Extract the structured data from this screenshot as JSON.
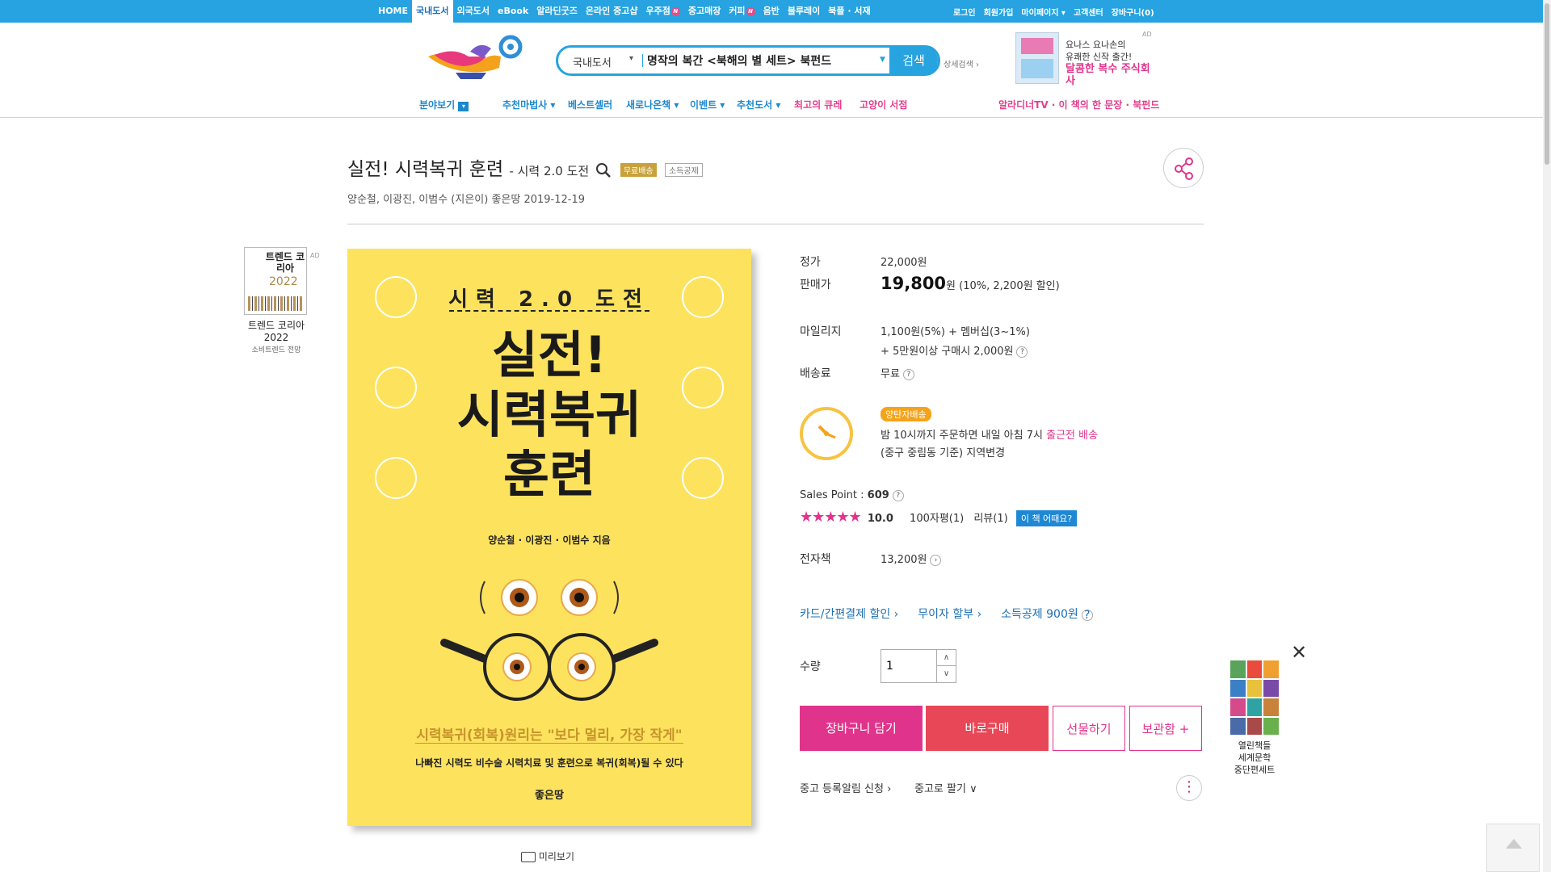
{
  "topnav": {
    "items": [
      "HOME",
      "국내도서",
      "외국도서",
      "eBook",
      "알라딘굿즈",
      "온라인 중고샵",
      "우주점",
      "중고매장",
      "커피",
      "음반",
      "블루레이",
      "북플 · 서재"
    ],
    "active": "국내도서",
    "new_badge": "N",
    "util": [
      "로그인",
      "회원가입",
      "마이페이지 ▾",
      "고객센터",
      "장바구니(0)"
    ]
  },
  "search": {
    "category": "국내도서",
    "value": "명작의 복간 <북해의 별 세트> 북펀드",
    "button": "검색",
    "detail": "상세검색 ›"
  },
  "header_ad": {
    "tag": "AD",
    "line1": "요나스 요나손의",
    "line2": "유쾌한 신작 출간!",
    "line3": "달콤한 복수 주식회사"
  },
  "subnav": {
    "field": "분야보기",
    "items": [
      "추천마법사 ▾",
      "베스트셀러",
      "새로나온책 ▾",
      "이벤트 ▾",
      "추천도서 ▾",
      "최고의 큐레",
      "고양이 서점"
    ],
    "right": "알라디너TV · 이 책의 한 문장 · 북펀드"
  },
  "product": {
    "title": "실전! 시력복귀 훈련",
    "subtitle": "- 시력 2.0 도전",
    "badge_free": "무료배송",
    "badge_tax": "소득공제",
    "authors": "양순철,  이광진,  이범수 (지은이)  좋은땅  2019-12-19",
    "preview": "미리보기"
  },
  "left_ad": {
    "tag": "AD",
    "book_title": "트렌드 코리아",
    "book_year": "2022",
    "name": "트렌드 코리아 2022",
    "desc": "소비트렌드 전망"
  },
  "cover": {
    "top": "시력 2.0 도전",
    "line1": "실전!",
    "line2": "시력복귀",
    "line3": "훈련",
    "authors": "양순철 · 이광진 · 이범수 지음",
    "tagline_pre": "시력복귀(회복)원리는",
    "tagline_quote": "\"보다 멀리, 가장 작게\"",
    "tag2": "나빠진 시력도 비수술 시력치료 및 훈련으로 복귀(회복)될 수 있다",
    "pub": "좋은땅"
  },
  "price": {
    "list_label": "정가",
    "list_value": "22,000원",
    "sale_label": "판매가",
    "sale_value": "19,800",
    "sale_unit": "원",
    "sale_discount": "(10%, 2,200원 할인)",
    "mileage_label": "마일리지",
    "mileage_line1": "1,100원(5%) + 멤버십(3~1%)",
    "mileage_line2": "+ 5만원이상 구매시 2,000원",
    "shipping_label": "배송료",
    "shipping_value": "무료",
    "q": "?"
  },
  "dawn": {
    "badge": "양탄자배송",
    "line1_pre": "밤 10시까지 주문하면 내일 아침 7시",
    "line1_link": "출근전 배송",
    "line2": "(중구 중림동 기준) 지역변경"
  },
  "sales": {
    "label": "Sales Point : ",
    "value": "609",
    "stars": "★★★★★",
    "rating": "10.0",
    "reviews100": "100자평(1)",
    "reviews": "리뷰(1)",
    "how": "이 책 어때요?"
  },
  "ebook": {
    "label": "전자책",
    "value": "13,200원"
  },
  "links": [
    "카드/간편결제 할인 ›",
    "무이자 할부 ›",
    "소득공제 900원"
  ],
  "qty": {
    "label": "수량",
    "value": "1",
    "up": "∧",
    "down": "∨"
  },
  "buttons": {
    "cart": "장바구니 담기",
    "buy": "바로구매",
    "gift": "선물하기",
    "keep": "보관함 +"
  },
  "used": {
    "alert": "중고 등록알림 신청 ›",
    "sell": "중고로 팔기 ∨",
    "more": "⋮"
  },
  "right_ad": {
    "line1": "열린책들",
    "line2": "세계문학",
    "line3": "중단편세트",
    "close": "✕"
  }
}
